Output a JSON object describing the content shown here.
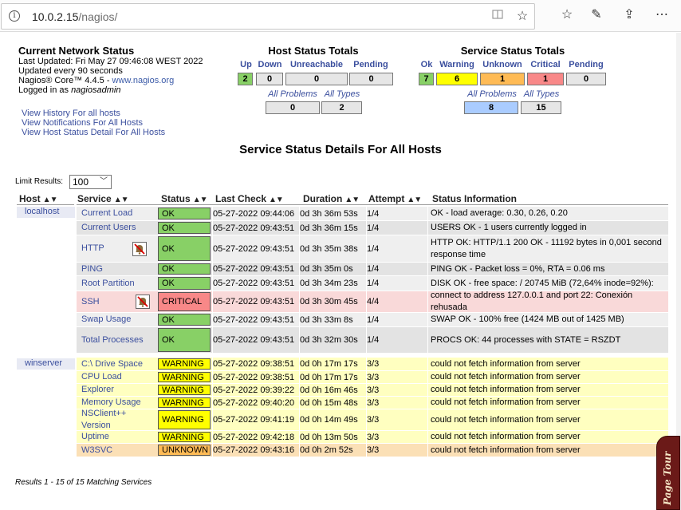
{
  "browser": {
    "url_host": "10.0.2.15",
    "url_path": "/nagios/",
    "icons": [
      "info-icon",
      "reader-view-icon",
      "favorite-star-icon",
      "favorites-list-icon",
      "pen-icon",
      "share-icon",
      "more-icon"
    ]
  },
  "status": {
    "title": "Current Network Status",
    "last_updated": "Last Updated: Fri May 27 09:46:08 WEST 2022",
    "update_interval": "Updated every 90 seconds",
    "core_prefix": "Nagios® Core™ 4.4.5 - ",
    "core_link": "www.nagios.org",
    "logged_prefix": "Logged in as ",
    "logged_user": "nagiosadmin",
    "links": [
      "View History For all hosts",
      "View Notifications For All Hosts",
      "View Host Status Detail For All Hosts"
    ]
  },
  "host_totals": {
    "title": "Host Status Totals",
    "labels": [
      "Up",
      "Down",
      "Unreachable",
      "Pending"
    ],
    "values": [
      "2",
      "0",
      "0",
      "0"
    ],
    "problem_labels": [
      "All Problems",
      "All Types"
    ],
    "problem_values": [
      "0",
      "2"
    ]
  },
  "service_totals": {
    "title": "Service Status Totals",
    "labels": [
      "Ok",
      "Warning",
      "Unknown",
      "Critical",
      "Pending"
    ],
    "values": [
      "7",
      "6",
      "1",
      "1",
      "0"
    ],
    "problem_labels": [
      "All Problems",
      "All Types"
    ],
    "problem_values": [
      "8",
      "15"
    ]
  },
  "colors": {
    "ok": "#88d066",
    "warning": "#ffff00",
    "unknown": "#ffbb55",
    "critical": "#f88888",
    "problems_box": "#aaccff",
    "link": "#3b4f9e"
  },
  "details": {
    "title": "Service Status Details For All Hosts",
    "limit_label": "Limit Results:",
    "limit_value": "100",
    "columns": [
      "Host",
      "Service",
      "Status",
      "Last Check",
      "Duration",
      "Attempt",
      "Status Information"
    ]
  },
  "hosts": [
    "localhost",
    "winserver"
  ],
  "rows": [
    {
      "service": "Current Load",
      "status": "OK",
      "last_check": "05-27-2022 09:44:06",
      "duration": "0d 3h 36m 53s",
      "attempt": "1/4",
      "info": "OK - load average: 0.30, 0.26, 0.20"
    },
    {
      "service": "Current Users",
      "status": "OK",
      "last_check": "05-27-2022 09:43:51",
      "duration": "0d 3h 36m 15s",
      "attempt": "1/4",
      "info": "USERS OK - 1 users currently logged in"
    },
    {
      "service": "HTTP",
      "status": "OK",
      "last_check": "05-27-2022 09:43:51",
      "duration": "0d 3h 35m 38s",
      "attempt": "1/4",
      "info": "HTTP OK: HTTP/1.1 200 OK - 11192 bytes in 0,001 second response time"
    },
    {
      "service": "PING",
      "status": "OK",
      "last_check": "05-27-2022 09:43:51",
      "duration": "0d 3h 35m 0s",
      "attempt": "1/4",
      "info": "PING OK - Packet loss = 0%, RTA = 0.06 ms"
    },
    {
      "service": "Root Partition",
      "status": "OK",
      "last_check": "05-27-2022 09:43:51",
      "duration": "0d 3h 34m 23s",
      "attempt": "1/4",
      "info": "DISK OK - free space: / 20745 MiB (72,64% inode=92%):"
    },
    {
      "service": "SSH",
      "status": "CRITICAL",
      "last_check": "05-27-2022 09:43:51",
      "duration": "0d 3h 30m 45s",
      "attempt": "4/4",
      "info": "connect to address 127.0.0.1 and port 22: Conexión rehusada"
    },
    {
      "service": "Swap Usage",
      "status": "OK",
      "last_check": "05-27-2022 09:43:51",
      "duration": "0d 3h 33m 8s",
      "attempt": "1/4",
      "info": "SWAP OK - 100% free (1424 MB out of 1425 MB)"
    },
    {
      "service": "Total Processes",
      "status": "OK",
      "last_check": "05-27-2022 09:43:51",
      "duration": "0d 3h 32m 30s",
      "attempt": "1/4",
      "info": "PROCS OK: 44 processes with STATE = RSZDT"
    },
    {
      "service": "C:\\ Drive Space",
      "status": "WARNING",
      "last_check": "05-27-2022 09:38:51",
      "duration": "0d 0h 17m 17s",
      "attempt": "3/3",
      "info": "could not fetch information from server"
    },
    {
      "service": "CPU Load",
      "status": "WARNING",
      "last_check": "05-27-2022 09:38:51",
      "duration": "0d 0h 17m 17s",
      "attempt": "3/3",
      "info": "could not fetch information from server"
    },
    {
      "service": "Explorer",
      "status": "WARNING",
      "last_check": "05-27-2022 09:39:22",
      "duration": "0d 0h 16m 46s",
      "attempt": "3/3",
      "info": "could not fetch information from server"
    },
    {
      "service": "Memory Usage",
      "status": "WARNING",
      "last_check": "05-27-2022 09:40:20",
      "duration": "0d 0h 15m 48s",
      "attempt": "3/3",
      "info": "could not fetch information from server"
    },
    {
      "service": "NSClient++ Version",
      "status": "WARNING",
      "last_check": "05-27-2022 09:41:19",
      "duration": "0d 0h 14m 49s",
      "attempt": "3/3",
      "info": "could not fetch information from server"
    },
    {
      "service": "Uptime",
      "status": "WARNING",
      "last_check": "05-27-2022 09:42:18",
      "duration": "0d 0h 13m 50s",
      "attempt": "3/3",
      "info": "could not fetch information from server"
    },
    {
      "service": "W3SVC",
      "status": "UNKNOWN",
      "last_check": "05-27-2022 09:43:16",
      "duration": "0d 0h 2m 52s",
      "attempt": "3/3",
      "info": "could not fetch information from server"
    }
  ],
  "results_text": "Results 1 - 15 of 15 Matching Services",
  "page_tour_label": "Page Tour"
}
